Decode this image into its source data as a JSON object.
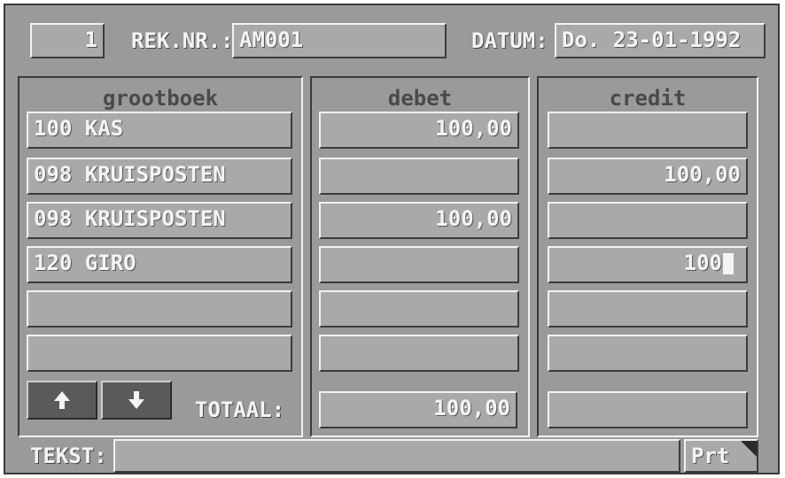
{
  "header": {
    "entry_number": "1",
    "rek_nr_label": "REK.NR.:",
    "rek_nr_value": "AM001",
    "datum_label": "DATUM:",
    "datum_value": "Do. 23-01-1992"
  },
  "columns": {
    "grootboek": "grootboek",
    "debet": "debet",
    "credit": "credit"
  },
  "rows": [
    {
      "grootboek": "100 KAS",
      "debet": "100,00",
      "credit": ""
    },
    {
      "grootboek": "098 KRUISPOSTEN",
      "debet": "",
      "credit": "100,00"
    },
    {
      "grootboek": "098 KRUISPOSTEN",
      "debet": "100,00",
      "credit": ""
    },
    {
      "grootboek": "120 GIRO",
      "debet": "",
      "credit": "100"
    },
    {
      "grootboek": "",
      "debet": "",
      "credit": ""
    },
    {
      "grootboek": "",
      "debet": "",
      "credit": ""
    }
  ],
  "totals": {
    "label": "TOTAAL:",
    "debet": "100,00",
    "credit": ""
  },
  "footer": {
    "tekst_label": "TEKST:",
    "tekst_value": "",
    "print_label": "Prt"
  },
  "icons": {
    "up": "arrow-up-icon",
    "down": "arrow-down-icon"
  }
}
